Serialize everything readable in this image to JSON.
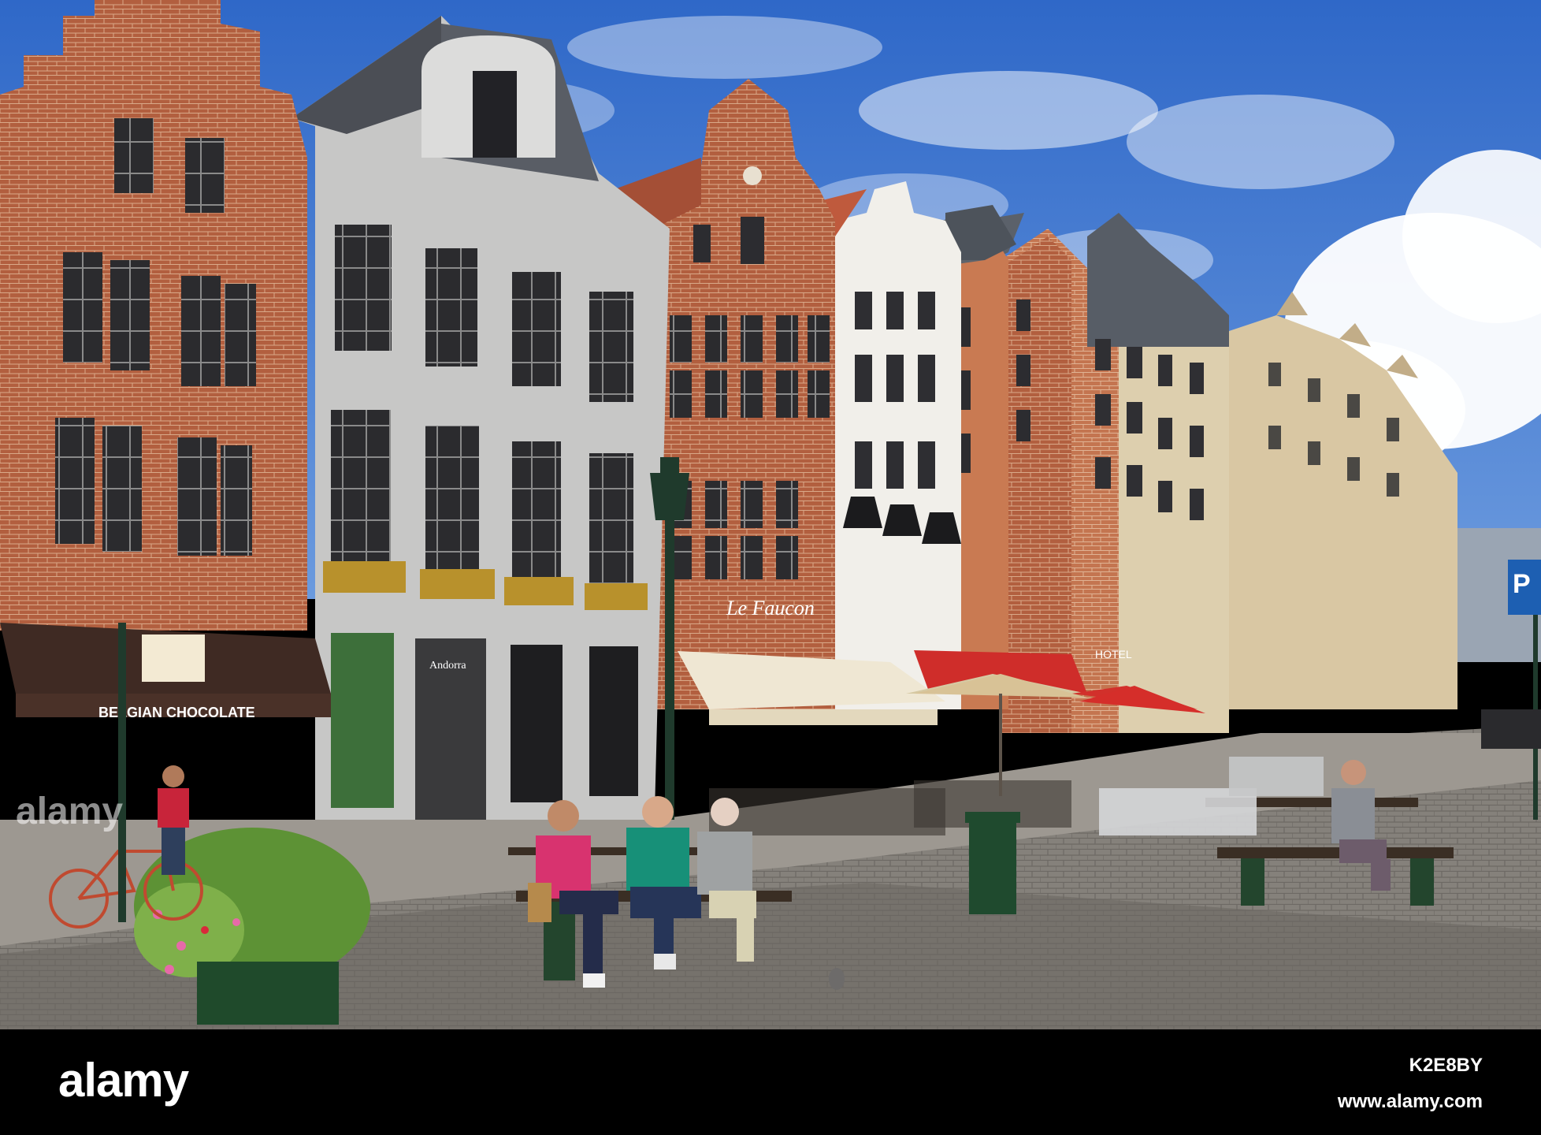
{
  "photo": {
    "description_hidden": "",
    "sky_color": "#3f78d0",
    "brick_color": "#b4603f",
    "cobble_color": "#8a8680"
  },
  "signs": {
    "chocolate_shop": "BELGIAN CHOCOLATE",
    "andorra": "Andorra",
    "restaurant": "Le Faucon",
    "hotel": "HOTEL",
    "parking": "P",
    "watermark_centre": "alamy"
  },
  "footer": {
    "logo": "alamy",
    "image_id": "K2E8BY",
    "url": "www.alamy.com"
  }
}
